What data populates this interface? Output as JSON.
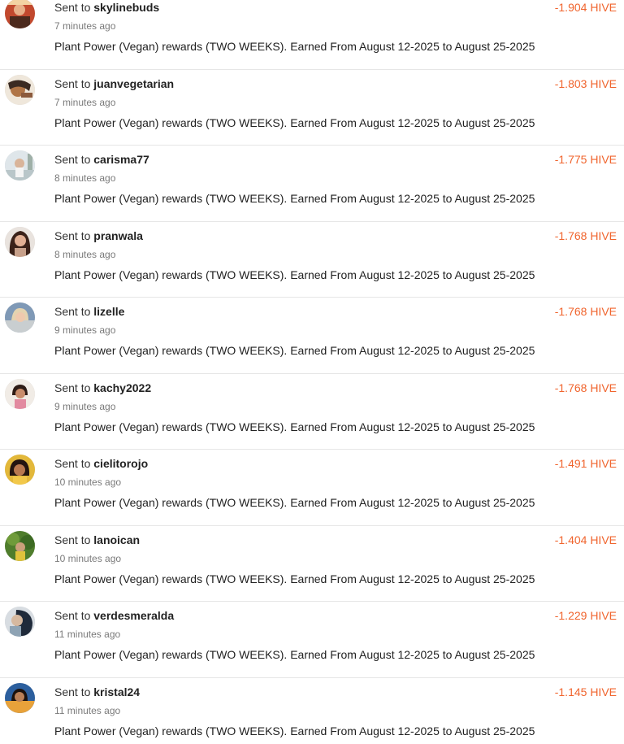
{
  "colors": {
    "amount": "#f0642d",
    "divider": "#e6e6e6"
  },
  "transfers": [
    {
      "prefix": "Sent to",
      "user": "skylinebuds",
      "time": "7 minutes ago",
      "memo": "Plant Power (Vegan) rewards (TWO WEEKS). Earned From August 12-2025 to August 25-2025",
      "amount": "-1.904 HIVE"
    },
    {
      "prefix": "Sent to",
      "user": "juanvegetarian",
      "time": "7 minutes ago",
      "memo": "Plant Power (Vegan) rewards (TWO WEEKS). Earned From August 12-2025 to August 25-2025",
      "amount": "-1.803 HIVE"
    },
    {
      "prefix": "Sent to",
      "user": "carisma77",
      "time": "8 minutes ago",
      "memo": "Plant Power (Vegan) rewards (TWO WEEKS). Earned From August 12-2025 to August 25-2025",
      "amount": "-1.775 HIVE"
    },
    {
      "prefix": "Sent to",
      "user": "pranwala",
      "time": "8 minutes ago",
      "memo": "Plant Power (Vegan) rewards (TWO WEEKS). Earned From August 12-2025 to August 25-2025",
      "amount": "-1.768 HIVE"
    },
    {
      "prefix": "Sent to",
      "user": "lizelle",
      "time": "9 minutes ago",
      "memo": "Plant Power (Vegan) rewards (TWO WEEKS). Earned From August 12-2025 to August 25-2025",
      "amount": "-1.768 HIVE"
    },
    {
      "prefix": "Sent to",
      "user": "kachy2022",
      "time": "9 minutes ago",
      "memo": "Plant Power (Vegan) rewards (TWO WEEKS). Earned From August 12-2025 to August 25-2025",
      "amount": "-1.768 HIVE"
    },
    {
      "prefix": "Sent to",
      "user": "cielitorojo",
      "time": "10 minutes ago",
      "memo": "Plant Power (Vegan) rewards (TWO WEEKS). Earned From August 12-2025 to August 25-2025",
      "amount": "-1.491 HIVE"
    },
    {
      "prefix": "Sent to",
      "user": "lanoican",
      "time": "10 minutes ago",
      "memo": "Plant Power (Vegan) rewards (TWO WEEKS). Earned From August 12-2025 to August 25-2025",
      "amount": "-1.404 HIVE"
    },
    {
      "prefix": "Sent to",
      "user": "verdesmeralda",
      "time": "11 minutes ago",
      "memo": "Plant Power (Vegan) rewards (TWO WEEKS). Earned From August 12-2025 to August 25-2025",
      "amount": "-1.229 HIVE"
    },
    {
      "prefix": "Sent to",
      "user": "kristal24",
      "time": "11 minutes ago",
      "memo": "Plant Power (Vegan) rewards (TWO WEEKS). Earned From August 12-2025 to August 25-2025",
      "amount": "-1.145 HIVE"
    }
  ]
}
